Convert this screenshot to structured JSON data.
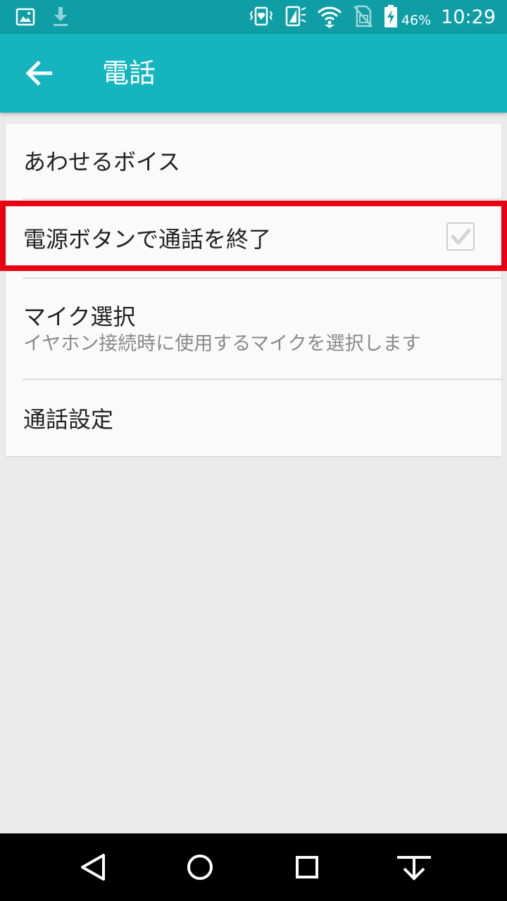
{
  "status_bar": {
    "battery_percent": "46%",
    "time": "10:29",
    "icons_left": [
      "image-notification-icon",
      "download-icon"
    ],
    "icons_right": [
      "vibrate-heart-icon",
      "screen-flash-icon",
      "wifi-icon",
      "no-sim-icon",
      "battery-charging-icon"
    ]
  },
  "app_bar": {
    "title": "電話",
    "back_icon": "arrow-left-icon",
    "background_color": "#14b5bf"
  },
  "settings": {
    "items": [
      {
        "title": "あわせるボイス"
      },
      {
        "title": "電源ボタンで通話を終了",
        "checked": true
      },
      {
        "title": "マイク選択",
        "summary": "イヤホン接続時に使用するマイクを選択します"
      },
      {
        "title": "通話設定"
      }
    ]
  },
  "highlight": {
    "color": "#e60012"
  },
  "nav_bar": {
    "buttons": [
      "back-triangle-icon",
      "home-circle-icon",
      "recents-square-icon",
      "notification-pull-icon"
    ]
  }
}
